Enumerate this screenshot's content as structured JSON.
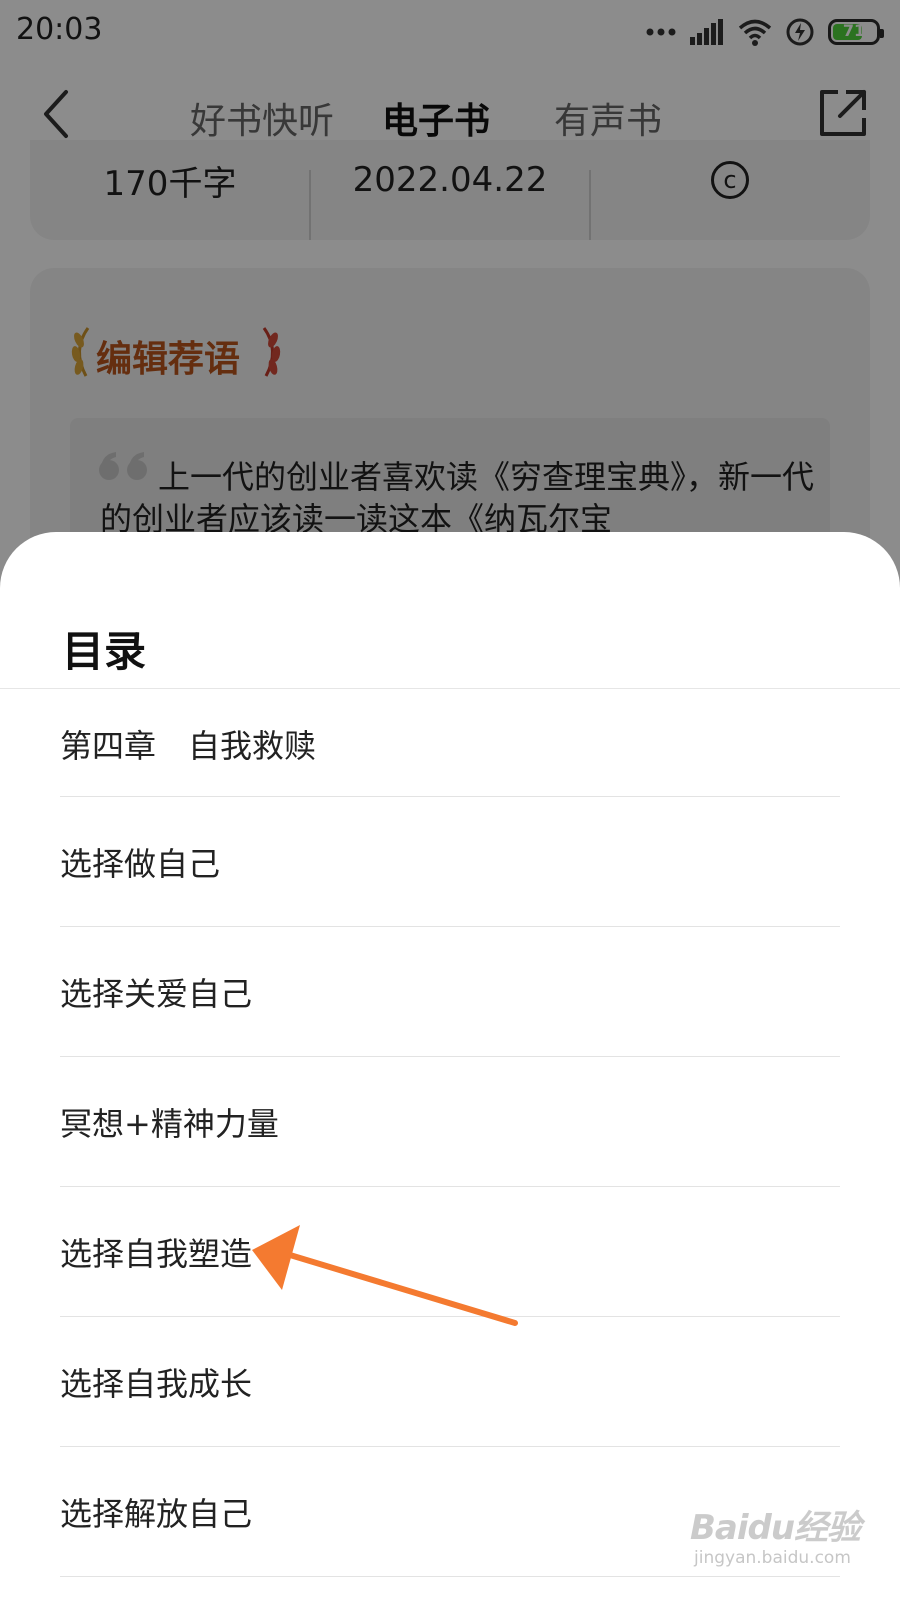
{
  "status_bar": {
    "time": "20:03",
    "battery": "71",
    "battery_level": 0.71
  },
  "nav": {
    "tabs": [
      {
        "label": "好书快听",
        "active": false
      },
      {
        "label": "电子书",
        "active": true
      },
      {
        "label": "有声书",
        "active": false
      }
    ],
    "back_icon": "chevron-left-icon",
    "share_icon": "share-icon"
  },
  "meta": {
    "words": "170千字",
    "date": "2022.04.22",
    "copyright_symbol": "c"
  },
  "editor": {
    "title": "编辑荐语",
    "quote": "上一代的创业者喜欢读《穷查理宝典》，新一代的创业者应该读一读这本《纳瓦尔宝"
  },
  "toc": {
    "title": "目录",
    "items": [
      "第四章　自我救赎",
      "选择做自己",
      "选择关爱自己",
      "冥想+精神力量",
      "选择自我塑造",
      "选择自我成长",
      "选择解放自己"
    ]
  },
  "colors": {
    "accent": "#e03a3a",
    "arrow": "#f47a30",
    "editor_title": "#b8541d"
  },
  "watermark": {
    "logo": "Baidu经验",
    "url": "jingyan.baidu.com"
  }
}
